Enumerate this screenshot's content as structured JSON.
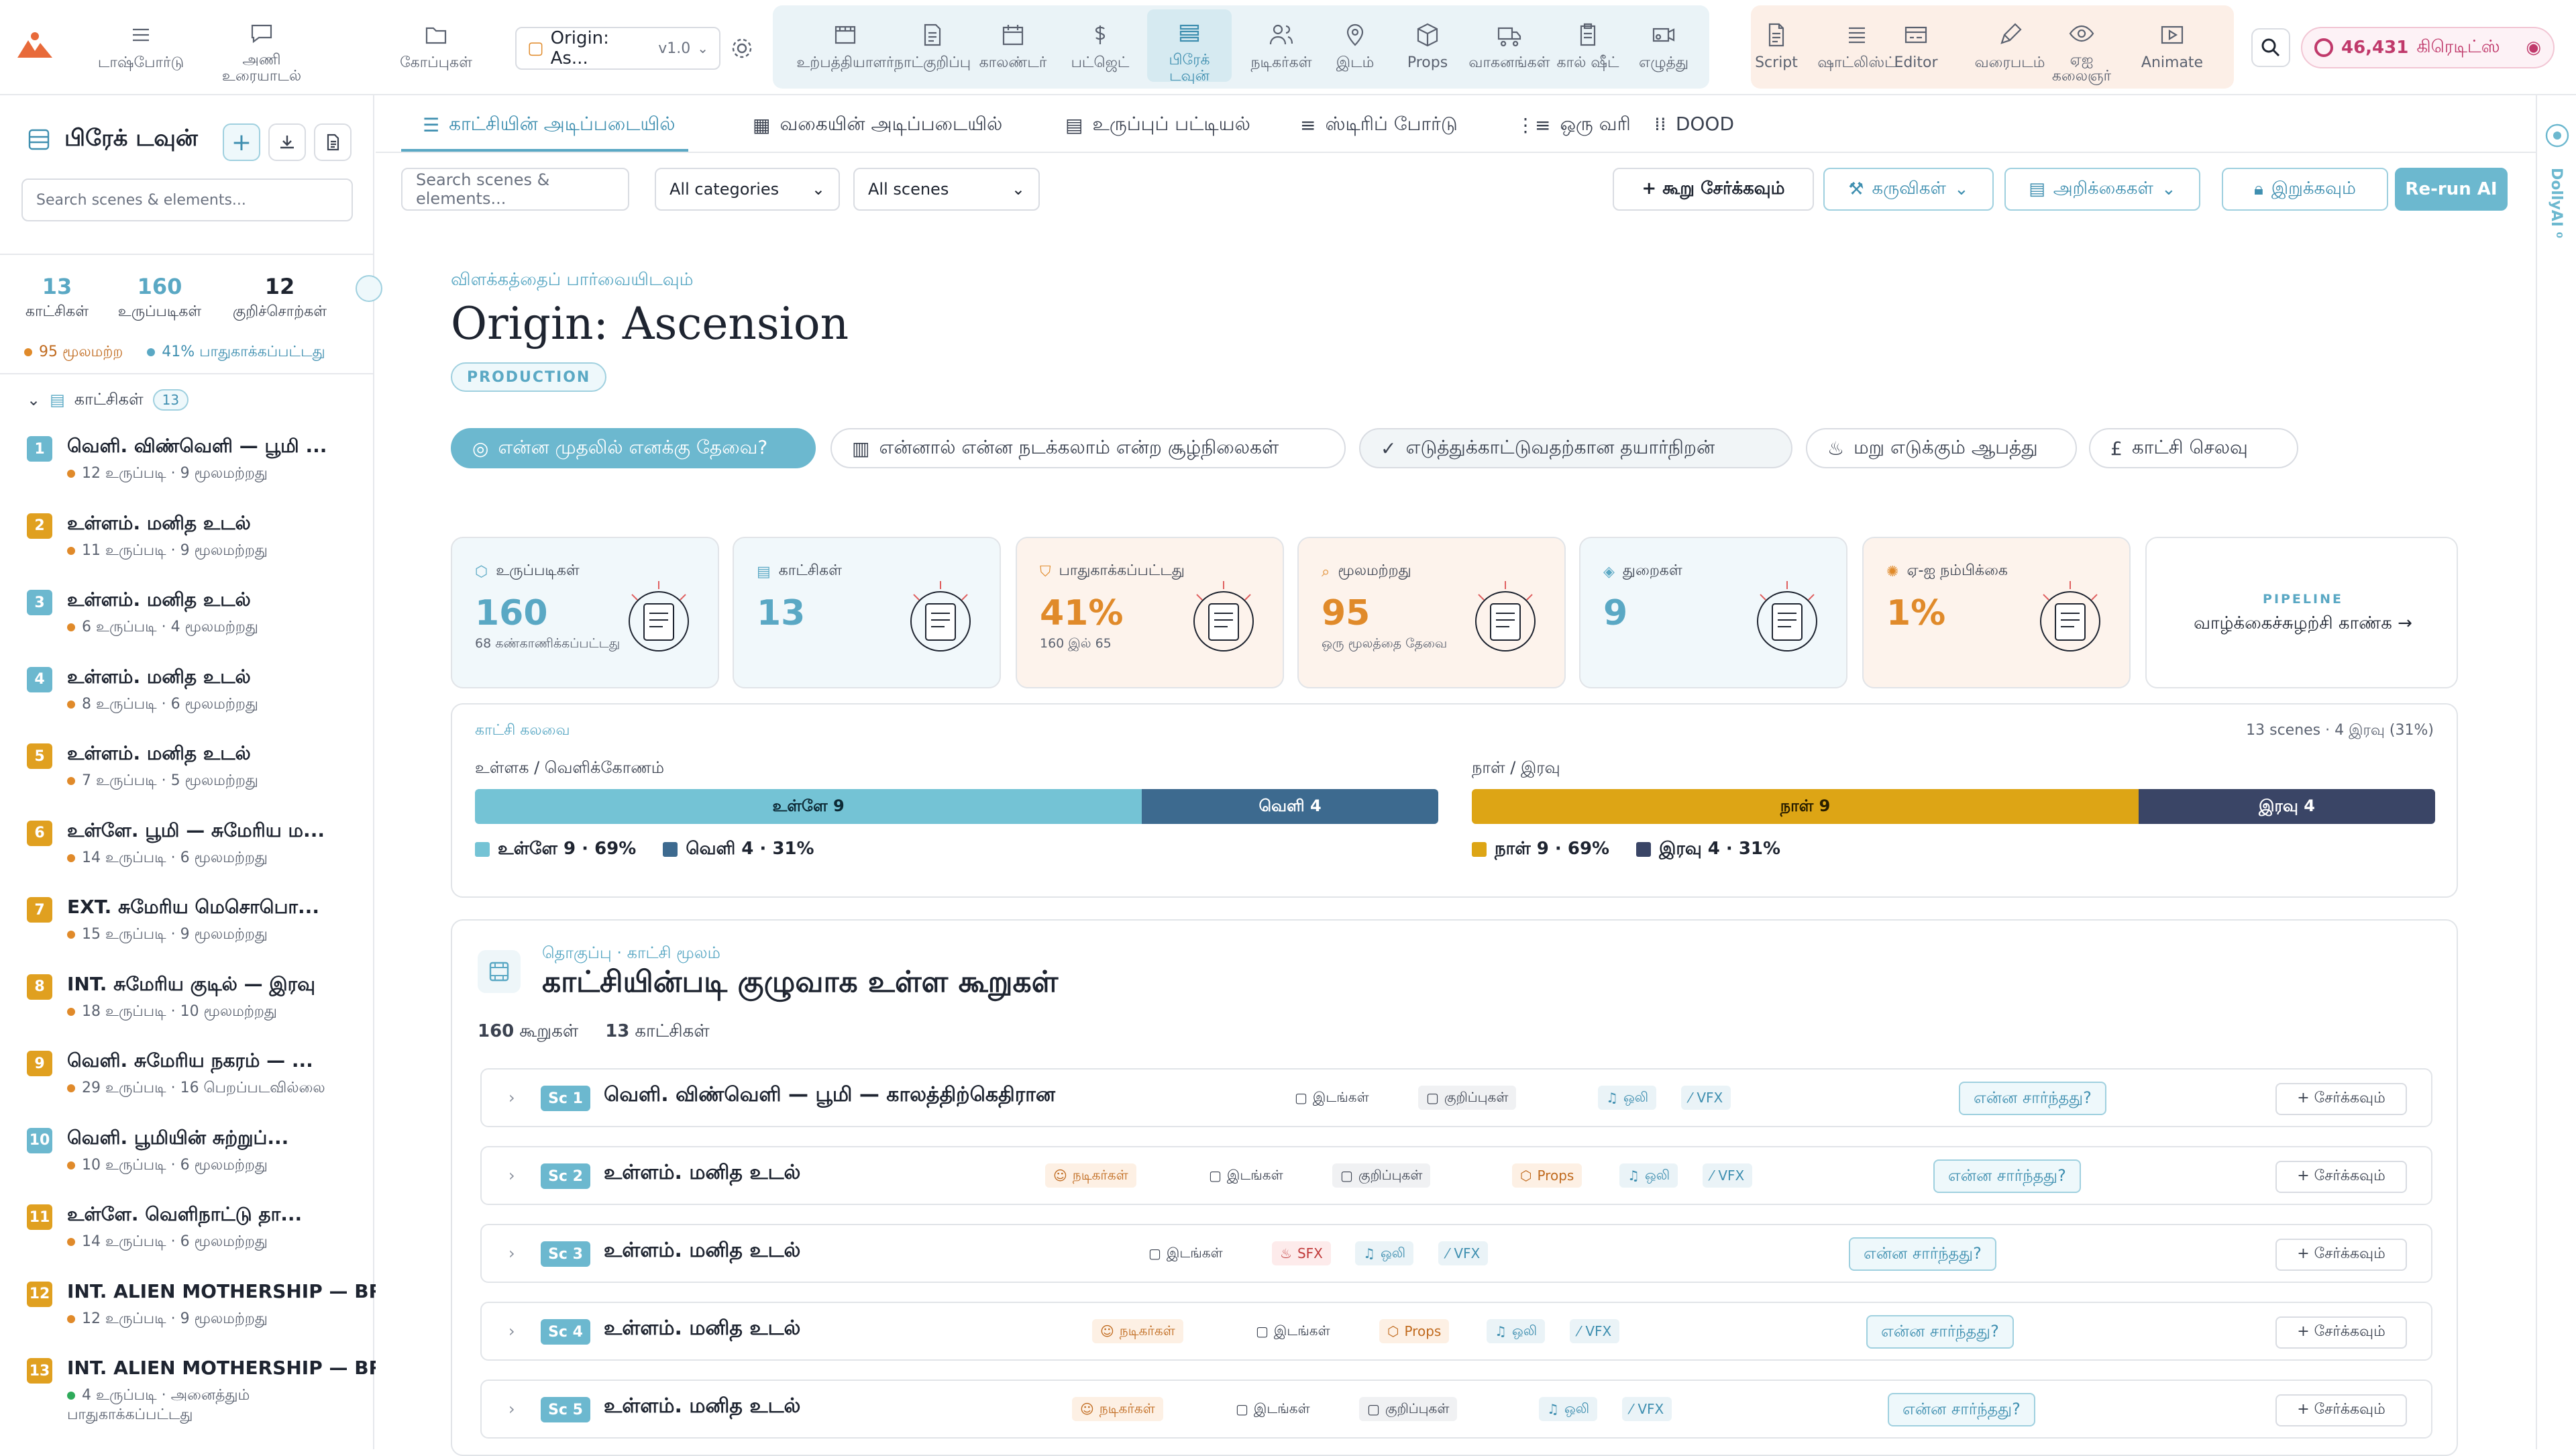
{
  "nav": {
    "left": [
      {
        "label": "டாஷ்போர்டு",
        "icon": "menu-icon"
      },
      {
        "label": "அணி உரையாடல்",
        "icon": "chat-icon"
      },
      {
        "label": "கோப்புகள்",
        "icon": "folder-icon"
      }
    ],
    "project": {
      "name": "Origin: As...",
      "version": "v1.0"
    },
    "blue_group": [
      {
        "label": "உற்பத்தியாளர்",
        "icon": "film-icon"
      },
      {
        "label": "நாட்குறிப்பு",
        "icon": "notes-icon"
      },
      {
        "label": "காலண்டர்",
        "icon": "calendar-icon"
      },
      {
        "label": "பட்ஜெட்",
        "icon": "dollar-icon"
      },
      {
        "label": "பிரேக் டவுன்",
        "icon": "breakdown-icon"
      },
      {
        "label": "நடிகர்கள்",
        "icon": "people-icon"
      },
      {
        "label": "இடம்",
        "icon": "location-icon"
      },
      {
        "label": "Props",
        "icon": "cube-icon"
      },
      {
        "label": "வாகனங்கள்",
        "icon": "truck-icon"
      },
      {
        "label": "கால் ஷீட்",
        "icon": "clipboard-icon"
      },
      {
        "label": "எழுத்து",
        "icon": "camera-icon"
      }
    ],
    "peach_group": [
      {
        "label": "Script",
        "icon": "script-icon"
      },
      {
        "label": "ஷாட்லிஸ்ட்",
        "icon": "list-icon"
      },
      {
        "label": "Editor",
        "icon": "editor-icon"
      },
      {
        "label": "வரைபடம்",
        "icon": "pen-icon"
      },
      {
        "label": "ஏஐ கலைஞர்",
        "icon": "eye-icon"
      },
      {
        "label": "Animate",
        "icon": "play-icon"
      }
    ],
    "credits": {
      "value": "46,431",
      "label": "கிரெடிட்ஸ்"
    }
  },
  "sidebar": {
    "title": "பிரேக் டவுன்",
    "search_placeholder": "Search scenes & elements...",
    "stats": [
      {
        "n": "13",
        "label": "காட்சிகள்"
      },
      {
        "n": "160",
        "label": "உருப்படிகள்"
      },
      {
        "n": "12",
        "label": "குறிச்சொற்கள்"
      }
    ],
    "meta": [
      {
        "text": "95 மூலமற்ற",
        "color": "#e08a2a"
      },
      {
        "text": "41% பாதுகாக்கப்பட்டது",
        "color": "#5aa8c4"
      }
    ],
    "scenes_label": "காட்சிகள்",
    "scenes_count": "13",
    "scenes": [
      {
        "n": "1",
        "title": "வெளி. விண்வெளி — பூமி ...",
        "sub": "12 உருப்படி · 9 மூலமற்றது",
        "color": "#6cb8cf",
        "dot": "#e08a2a"
      },
      {
        "n": "2",
        "title": "உள்ளம். மனித உடல்",
        "sub": "11 உருப்படி · 9 மூலமற்றது",
        "color": "#e0a020",
        "dot": "#e08a2a"
      },
      {
        "n": "3",
        "title": "உள்ளம். மனித உடல்",
        "sub": "6 உருப்படி · 4 மூலமற்றது",
        "color": "#6cb8cf",
        "dot": "#e08a2a"
      },
      {
        "n": "4",
        "title": "உள்ளம். மனித உடல்",
        "sub": "8 உருப்படி · 6 மூலமற்றது",
        "color": "#6cb8cf",
        "dot": "#e08a2a"
      },
      {
        "n": "5",
        "title": "உள்ளம். மனித உடல்",
        "sub": "7 உருப்படி · 5 மூலமற்றது",
        "color": "#e0a020",
        "dot": "#e08a2a"
      },
      {
        "n": "6",
        "title": "உள்ளே. பூமி — சுமேரிய ம...",
        "sub": "14 உருப்படி · 6 மூலமற்றது",
        "color": "#e0a020",
        "dot": "#e08a2a"
      },
      {
        "n": "7",
        "title": "EXT. சுமேரிய மெசொபொ...",
        "sub": "15 உருப்படி · 9 மூலமற்றது",
        "color": "#e0a020",
        "dot": "#e08a2a"
      },
      {
        "n": "8",
        "title": "INT. சுமேரிய குடில் — இரவு",
        "sub": "18 உருப்படி · 10 மூலமற்றது",
        "color": "#e0a020",
        "dot": "#e08a2a"
      },
      {
        "n": "9",
        "title": "வெளி. சுமேரிய நகரம் — ...",
        "sub": "29 உருப்படி · 16 பெறப்படவில்லை",
        "color": "#e0a020",
        "dot": "#e08a2a"
      },
      {
        "n": "10",
        "title": "வெளி. பூமியின் சுற்றுப்...",
        "sub": "10 உருப்படி · 6 மூலமற்றது",
        "color": "#6cb8cf",
        "dot": "#e08a2a"
      },
      {
        "n": "11",
        "title": "உள்ளே. வெளிநாட்டு தா...",
        "sub": "14 உருப்படி · 6 மூலமற்றது",
        "color": "#e0a020",
        "dot": "#e08a2a"
      },
      {
        "n": "12",
        "title": "INT. ALIEN MOTHERSHIP — BR...",
        "sub": "12 உருப்படி · 9 மூலமற்றது",
        "color": "#e0a020",
        "dot": "#e08a2a"
      },
      {
        "n": "13",
        "title": "INT. ALIEN MOTHERSHIP — BR...",
        "sub": "4 உருப்படி · அனைத்தும் பாதுகாக்கப்பட்டது",
        "color": "#e0a020",
        "dot": "#2eaa5a"
      }
    ]
  },
  "tabs": [
    {
      "label": "காட்சியின் அடிப்படையில்",
      "icon": "list-icon",
      "active": true
    },
    {
      "label": "வகையின் அடிப்படையில்",
      "icon": "grid-icon"
    },
    {
      "label": "உருப்புப் பட்டியல்",
      "icon": "table-icon"
    },
    {
      "label": "ஸ்டிரிப் போர்டு",
      "icon": "lines-icon"
    },
    {
      "label": "ஒரு வரி",
      "icon": "bullets-icon"
    },
    {
      "label": "DOOD",
      "icon": "dots-icon"
    }
  ],
  "filters": {
    "search_placeholder": "Search scenes & elements...",
    "category": "All categories",
    "scenes": "All scenes",
    "add": "+ கூறு சேர்க்கவும்",
    "tools": "கருவிகள்",
    "reports": "அறிக்கைகள்",
    "lock": "இறுக்கவும்",
    "rerun": "Re-run AI"
  },
  "header": {
    "kicker": "விளக்கத்தைப் பார்வையிடவும்",
    "title": "Origin: Ascension",
    "badge": "PRODUCTION"
  },
  "pills": [
    "என்ன முதலில் எனக்கு தேவை?",
    "என்னால் என்ன நடக்கலாம் என்ற சூழ்நிலைகள்",
    "எடுத்துக்காட்டுவதற்கான தயார்நிறன்",
    "மறு எடுக்கும் ஆபத்து",
    "காட்சி செலவு"
  ],
  "cards": [
    {
      "label": "உருப்படிகள்",
      "value": "160",
      "note": "68 கண்காணிக்கப்பட்டது",
      "icon": "cube-icon"
    },
    {
      "label": "காட்சிகள்",
      "value": "13",
      "note": "",
      "icon": "film-icon"
    },
    {
      "label": "பாதுகாக்கப்பட்டது",
      "value": "41%",
      "note": "160 இல் 65",
      "icon": "shield-icon"
    },
    {
      "label": "மூலமற்றது",
      "value": "95",
      "note": "ஒரு மூலத்தை தேவை",
      "icon": "search-icon"
    },
    {
      "label": "துறைகள்",
      "value": "9",
      "note": "",
      "icon": "layers-icon"
    },
    {
      "label": "ஏ-ஐ நம்பிக்கை",
      "value": "1%",
      "note": "",
      "icon": "sparkle-icon"
    }
  ],
  "pipeline": {
    "kicker": "PIPELINE",
    "text": "வாழ்க்கைச்சுழற்சி காண்க →"
  },
  "mix": {
    "heading": "காட்சி கலவை",
    "summary": "13 scenes · 4 இரவு (31%)",
    "ie_label": "உள்ளக / வெளிக்கோணம்",
    "dn_label": "நாள் / இரவு",
    "ie": {
      "a_label": "உள்ளே 9",
      "a_value": 9,
      "b_label": "வெளி 4",
      "b_value": 4,
      "a_leg": "உள்ளே 9 · 69%",
      "b_leg": "வெளி 4 · 31%",
      "a_color": "#74c3d5",
      "b_color": "#3d6a8f"
    },
    "dn": {
      "a_label": "நாள் 9",
      "a_value": 9,
      "b_label": "இரவு 4",
      "b_value": 4,
      "a_leg": "நாள் 9 · 69%",
      "b_leg": "இரவு 4 · 31%",
      "a_color": "#dda515",
      "b_color": "#3a4566"
    }
  },
  "group": {
    "kicker": "தொகுப்பு · காட்சி மூலம்",
    "title": "காட்சியின்படி குழுவாக உள்ள கூறுகள்",
    "count_items": "160",
    "count_items_label": "கூறுகள்",
    "count_scenes": "13",
    "count_scenes_label": "காட்சிகள்",
    "relate": "என்ன சார்ந்தது?",
    "add": "+ சேர்க்கவும்",
    "rows": [
      {
        "sc": "Sc 1",
        "title": "வெளி. விண்வெளி — பூமி — காலத்திற்கெதிரான",
        "chips": [
          {
            "t": "இடங்கள்",
            "k": "plain"
          },
          {
            "t": "குறிப்புகள்",
            "k": "gray"
          },
          {
            "t": "ஒலி",
            "k": "blue"
          },
          {
            "t": "VFX",
            "k": "blue"
          }
        ]
      },
      {
        "sc": "Sc 2",
        "title": "உள்ளம். மனித உடல்",
        "chips": [
          {
            "t": "நடிகர்கள்",
            "k": "orange"
          },
          {
            "t": "இடங்கள்",
            "k": "plain"
          },
          {
            "t": "குறிப்புகள்",
            "k": "gray"
          },
          {
            "t": "Props",
            "k": "orange2"
          },
          {
            "t": "ஒலி",
            "k": "blue"
          },
          {
            "t": "VFX",
            "k": "blue"
          }
        ]
      },
      {
        "sc": "Sc 3",
        "title": "உள்ளம். மனித உடல்",
        "chips": [
          {
            "t": "இடங்கள்",
            "k": "plain"
          },
          {
            "t": "SFX",
            "k": "red"
          },
          {
            "t": "ஒலி",
            "k": "blue"
          },
          {
            "t": "VFX",
            "k": "blue"
          }
        ]
      },
      {
        "sc": "Sc 4",
        "title": "உள்ளம். மனித உடல்",
        "chips": [
          {
            "t": "நடிகர்கள்",
            "k": "orange"
          },
          {
            "t": "இடங்கள்",
            "k": "plain"
          },
          {
            "t": "Props",
            "k": "orange2"
          },
          {
            "t": "ஒலி",
            "k": "blue"
          },
          {
            "t": "VFX",
            "k": "blue"
          }
        ]
      },
      {
        "sc": "Sc 5",
        "title": "உள்ளம். மனித உடல்",
        "chips": [
          {
            "t": "நடிகர்கள்",
            "k": "orange"
          },
          {
            "t": "இடங்கள்",
            "k": "plain"
          },
          {
            "t": "குறிப்புகள்",
            "k": "gray"
          },
          {
            "t": "ஒலி",
            "k": "blue"
          },
          {
            "t": "VFX",
            "k": "blue"
          }
        ]
      }
    ]
  },
  "rail": {
    "text": "DollyAI ⁰"
  }
}
